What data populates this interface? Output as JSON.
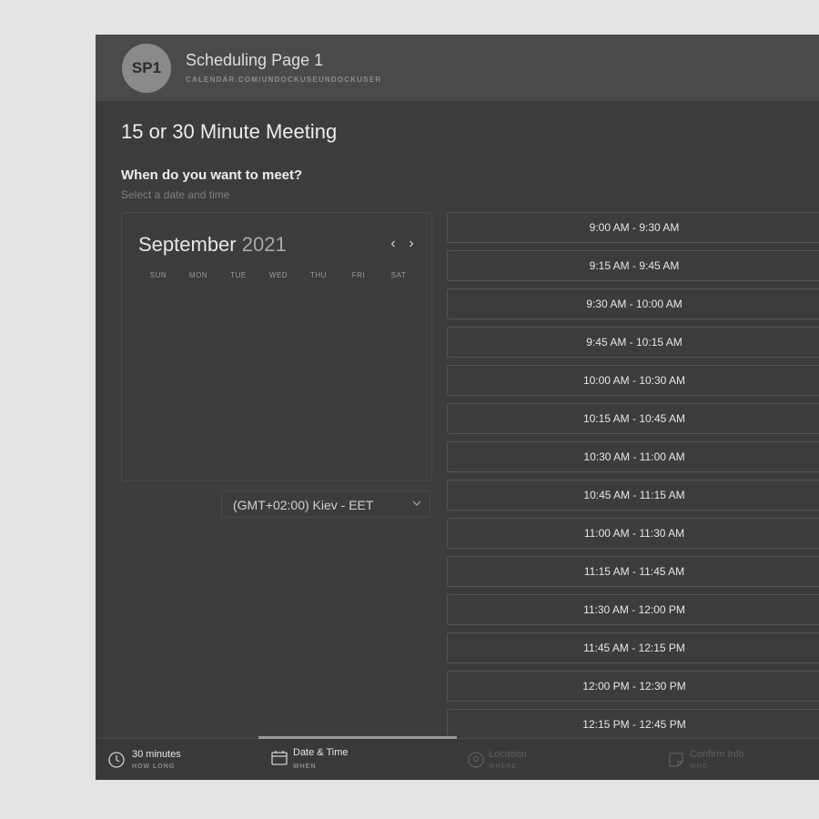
{
  "header": {
    "avatar_initials": "SP1",
    "page_name": "Scheduling Page 1",
    "page_url": "CALENDAR.COM/UNDOCKUSEUNDOCKUSER"
  },
  "meeting_title": "15 or 30 Minute Meeting",
  "prompt": {
    "question": "When do you want to meet?",
    "hint": "Select a date and time"
  },
  "calendar": {
    "month": "September",
    "year": "2021",
    "prev_label": "‹",
    "next_label": "›",
    "weekdays": [
      "SUN",
      "MON",
      "TUE",
      "WED",
      "THU",
      "FRI",
      "SAT"
    ]
  },
  "timezone": {
    "label": "(GMT+02:00) Kiev - EET"
  },
  "time_slots": [
    "9:00 AM - 9:30 AM",
    "9:15 AM - 9:45 AM",
    "9:30 AM - 10:00 AM",
    "9:45 AM - 10:15 AM",
    "10:00 AM - 10:30 AM",
    "10:15 AM - 10:45 AM",
    "10:30 AM - 11:00 AM",
    "10:45 AM - 11:15 AM",
    "11:00 AM - 11:30 AM",
    "11:15 AM - 11:45 AM",
    "11:30 AM - 12:00 PM",
    "11:45 AM - 12:15 PM",
    "12:00 PM - 12:30 PM",
    "12:15 PM - 12:45 PM"
  ],
  "steps": [
    {
      "label": "30 minutes",
      "sub": "HOW LONG",
      "icon": "clock-icon",
      "state": "done"
    },
    {
      "label": "Date & Time",
      "sub": "WHEN",
      "icon": "calendar-icon",
      "state": "active"
    },
    {
      "label": "Location",
      "sub": "WHERE",
      "icon": "location-pin-icon",
      "state": "pending"
    },
    {
      "label": "Confirm Info",
      "sub": "WHO",
      "icon": "note-icon",
      "state": "pending"
    }
  ],
  "colors": {
    "page_bg": "#e4e4e4",
    "panel_bg": "#3c3c3c",
    "header_bg": "#4a4a4a",
    "active_step": "#9a9a9a"
  }
}
